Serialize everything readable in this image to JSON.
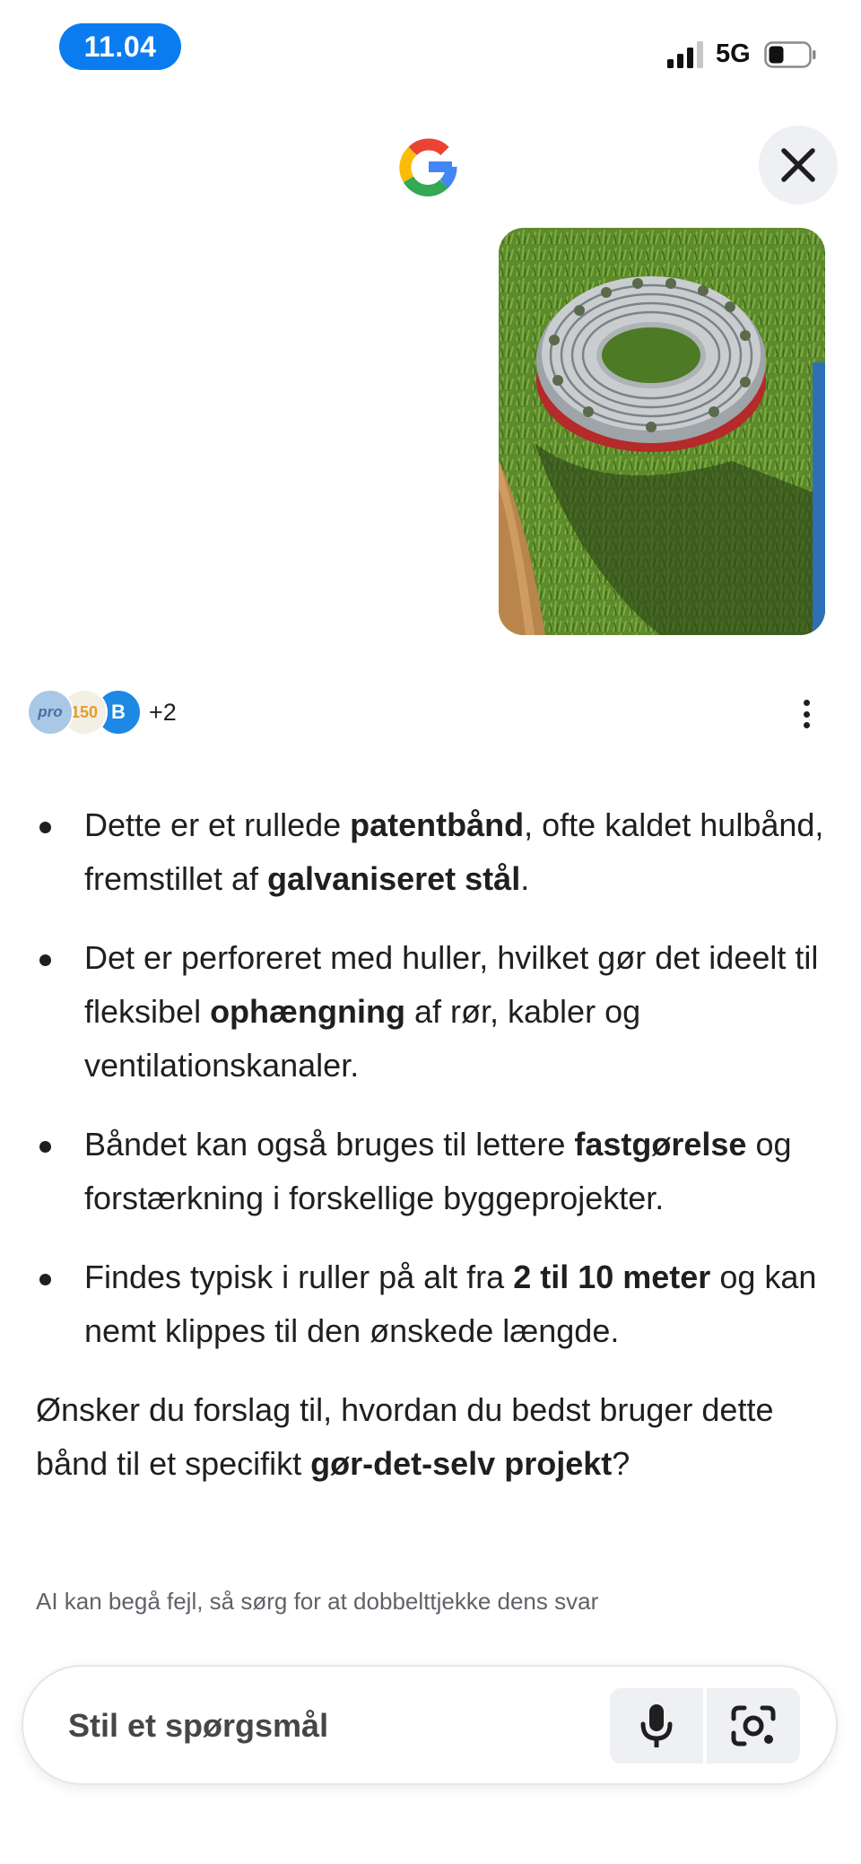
{
  "status_bar": {
    "time": "11.04",
    "network": "5G",
    "signal_icon": "cellular-signal-icon",
    "battery_icon": "battery-icon"
  },
  "header": {
    "logo_icon": "google-g-logo-icon",
    "close_icon": "close-icon"
  },
  "uploaded_image": {
    "subject": "roll of perforated galvanized steel strap on grass"
  },
  "sources": {
    "count_label": "+2",
    "icons": [
      "pro-source-icon",
      "150-source-icon",
      "b-source-icon"
    ],
    "more_icon": "more-vert-icon"
  },
  "answer": {
    "bullets": [
      {
        "parts": [
          {
            "t": "Dette er et rullede "
          },
          {
            "b": "patentbånd"
          },
          {
            "t": ", ofte kaldet hulbånd, fremstillet af "
          },
          {
            "b": "galvaniseret stål"
          },
          {
            "t": "."
          }
        ]
      },
      {
        "parts": [
          {
            "t": "Det er perforeret med huller, hvilket gør det ideelt til fleksibel "
          },
          {
            "b": "ophængning"
          },
          {
            "t": " af rør, kabler og ventilationskanaler."
          }
        ]
      },
      {
        "parts": [
          {
            "t": "Båndet kan også bruges til lettere "
          },
          {
            "b": "fastgørelse"
          },
          {
            "t": " og forstærkning i forskellige byggeprojekter."
          }
        ]
      },
      {
        "parts": [
          {
            "t": "Findes typisk i ruller på alt fra "
          },
          {
            "b": "2 til 10 meter"
          },
          {
            "t": " og kan nemt klippes til den ønskede længde."
          }
        ]
      }
    ],
    "closing": {
      "parts": [
        {
          "t": "Ønsker du forslag til, hvordan du bedst bruger dette bånd til et specifikt "
        },
        {
          "b": "gør-det-selv projekt"
        },
        {
          "t": "?"
        }
      ]
    }
  },
  "disclaimer": "AI kan begå fejl, så sørg for at dobbelttjekke dens svar",
  "search": {
    "placeholder": "Stil et spørgsmål",
    "value": "",
    "mic_icon": "microphone-icon",
    "lens_icon": "google-lens-icon"
  },
  "colors": {
    "time_pill": "#0a7cf0",
    "button_bg": "#eef0f3",
    "text": "#1f1f1f",
    "muted": "#5f6368"
  }
}
